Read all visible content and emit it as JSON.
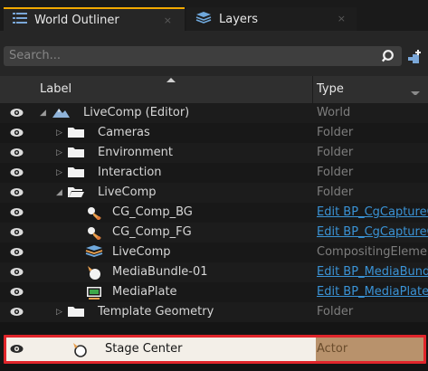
{
  "tabs": {
    "outliner": {
      "label": "World Outliner",
      "close": "×"
    },
    "layers": {
      "label": "Layers",
      "close": "×"
    }
  },
  "search": {
    "placeholder": "Search..."
  },
  "columns": {
    "label": "Label",
    "type": "Type"
  },
  "rows": [
    {
      "label": "LiveComp (Editor)",
      "type": "World",
      "icon": "world-icon",
      "expanded": true,
      "type_link": false
    },
    {
      "label": "Cameras",
      "type": "Folder",
      "icon": "folder-icon",
      "expanded": false,
      "type_link": false
    },
    {
      "label": "Environment",
      "type": "Folder",
      "icon": "folder-icon",
      "expanded": false,
      "type_link": false
    },
    {
      "label": "Interaction",
      "type": "Folder",
      "icon": "folder-icon",
      "expanded": false,
      "type_link": false
    },
    {
      "label": "LiveComp",
      "type": "Folder",
      "icon": "folder-open-icon",
      "expanded": true,
      "type_link": false
    },
    {
      "label": "CG_Comp_BG",
      "type": "Edit BP_CgCaptureCompositingElement",
      "icon": "cg-capture-icon",
      "type_link": true
    },
    {
      "label": "CG_Comp_FG",
      "type": "Edit BP_CgCaptureCompositingElement",
      "icon": "cg-capture-icon",
      "type_link": true
    },
    {
      "label": "LiveComp",
      "type": "CompositingElement",
      "icon": "compositing-element-icon",
      "type_link": false
    },
    {
      "label": "MediaBundle-01",
      "type": "Edit BP_MediaBundle",
      "icon": "actor-icon",
      "type_link": true
    },
    {
      "label": "MediaPlate",
      "type": "Edit BP_MediaPlate",
      "icon": "media-plate-icon",
      "type_link": true
    },
    {
      "label": "Template Geometry",
      "type": "Folder",
      "icon": "folder-icon",
      "expanded": false,
      "type_link": false
    }
  ],
  "selected_row": {
    "label": "Stage Center",
    "type": "Actor",
    "icon": "actor-icon"
  },
  "colors": {
    "accent_tab": "#f2a900",
    "link": "#3a93d6",
    "highlight_border": "#e0252b",
    "selection_bg": "#f3efe8",
    "selection_type_bg": "#b8926c"
  }
}
